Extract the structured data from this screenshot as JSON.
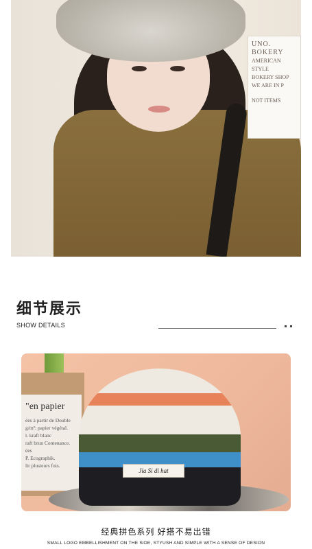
{
  "hero_card": {
    "line1": "UNO. BOKERY",
    "line2": "AMERICAN STYLE",
    "line3": "BOKERY SHOP",
    "line4": "WE ARE IN P",
    "line5": "NOT ITEMS"
  },
  "section": {
    "title": "细节展示",
    "subtitle": "SHOW DETAILS"
  },
  "detail_paper": {
    "heading": "\"en papier",
    "lines": [
      "ées à partir de Double",
      "g/m²: papier végétal.",
      "l. kraft blanc",
      "raft brun Contenance.",
      "ées",
      "P. Ecographik.",
      "lir plusieurs fois."
    ]
  },
  "hat_label": "Jia Si di hat",
  "caption": {
    "cn": "经典拼色系列 好搭不易出错",
    "en": "SMALL LOGO EMBELLISHMENT ON THE SIDE, STYUSH AND SIMPLE WITH A SENSE OF DESION"
  },
  "colors": {
    "stripe_orange": "#e8825a",
    "stripe_green": "#4a5a34",
    "stripe_blue": "#3f8fc9",
    "stripe_black": "#1e1e22"
  }
}
